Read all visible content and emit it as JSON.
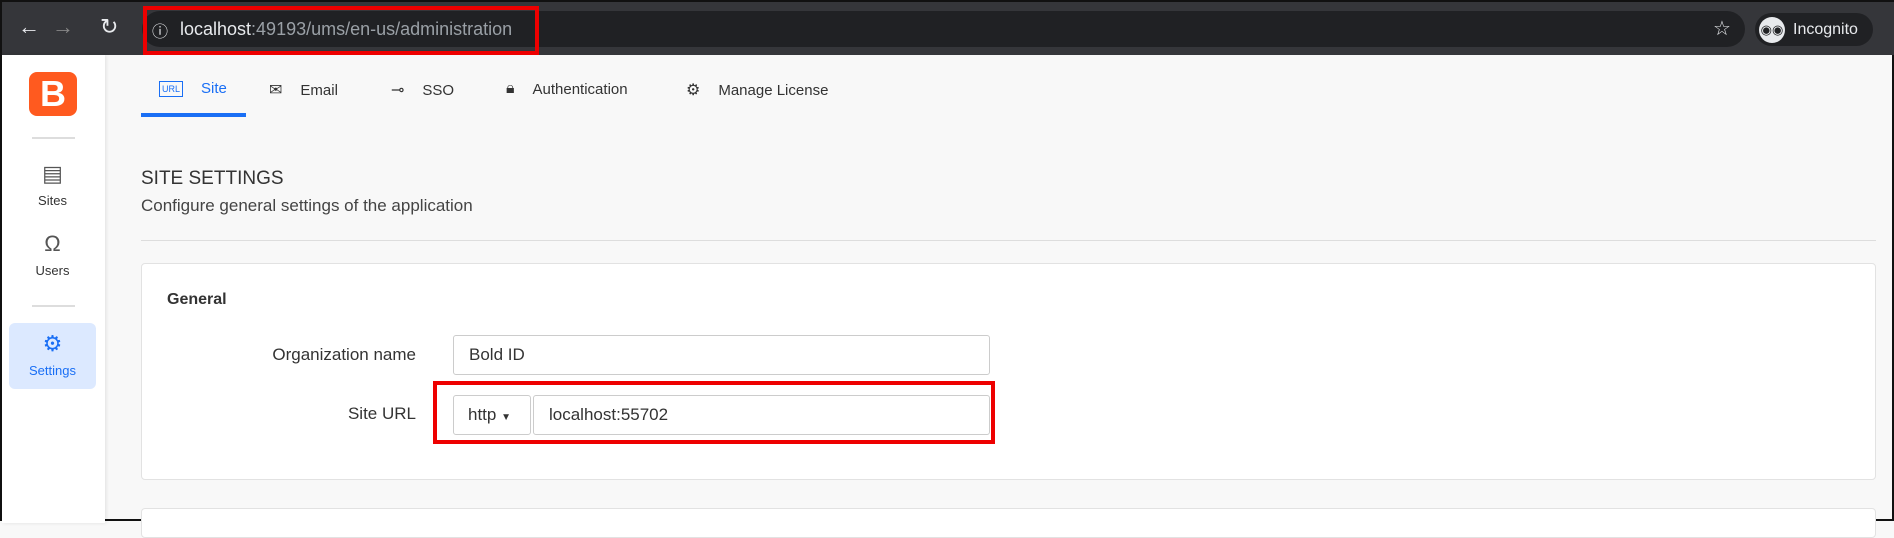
{
  "browser": {
    "url_host": "localhost",
    "url_rest": ":49193/ums/en-us/administration",
    "profile_label": "Incognito"
  },
  "sidebar": {
    "logo": "B",
    "items": [
      {
        "label": "Sites",
        "icon": "archive-icon"
      },
      {
        "label": "Users",
        "icon": "user-icon"
      },
      {
        "label": "Settings",
        "icon": "gear-icon",
        "active": true
      }
    ]
  },
  "tabs": [
    {
      "label": "Site",
      "icon": "url-icon",
      "active": true
    },
    {
      "label": "Email",
      "icon": "envelope-icon"
    },
    {
      "label": "SSO",
      "icon": "key-icon"
    },
    {
      "label": "Authentication",
      "icon": "lock-icon"
    },
    {
      "label": "Manage License",
      "icon": "license-gear-icon"
    }
  ],
  "page": {
    "title": "SITE SETTINGS",
    "subtitle": "Configure general settings of the application"
  },
  "general": {
    "heading": "General",
    "org_label": "Organization name",
    "org_value": "Bold ID",
    "site_url_label": "Site URL",
    "protocol": "http",
    "site_url_value": "localhost:55702"
  },
  "colors": {
    "accent": "#1a6ff5",
    "brand": "#ff5a1f",
    "highlight": "#ee0000"
  }
}
